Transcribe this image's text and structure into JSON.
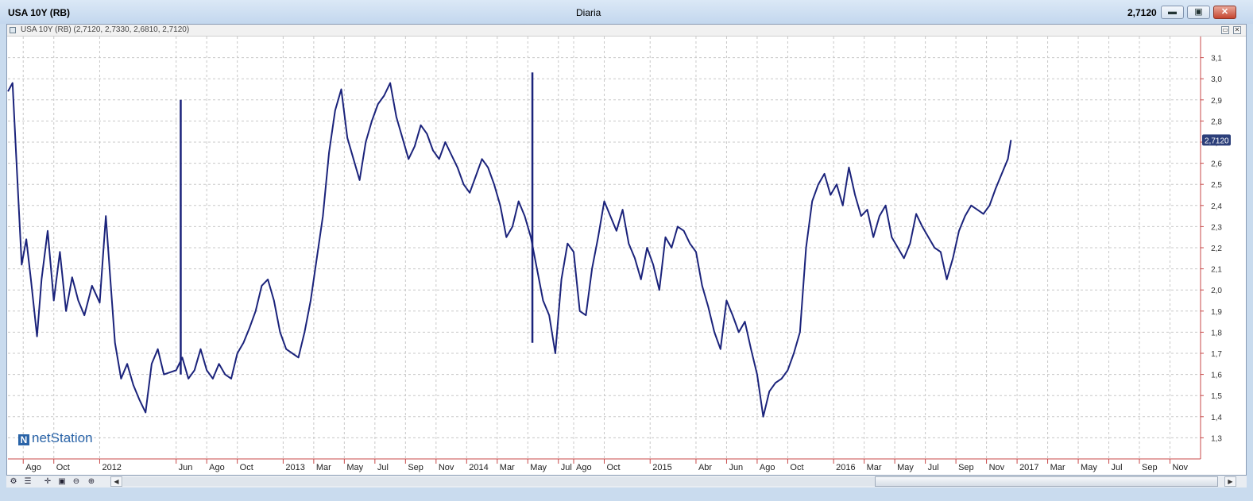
{
  "window": {
    "title": "USA 10Y (RB)",
    "period": "Diaria",
    "last_price": "2,7120",
    "minimize_icon": "minimize-icon",
    "maximize_icon": "maximize-icon",
    "close_icon": "close-icon"
  },
  "info_bar": {
    "text": "USA 10Y (RB) (2,7120, 2,7330, 2,6810, 2,7120)"
  },
  "logo": {
    "text": "netStation"
  },
  "status_bar": {
    "tools": [
      "settings-icon",
      "properties-icon",
      "crosshair-icon",
      "zoom-out-icon",
      "zoom-in-icon"
    ],
    "scroll_left": "◀",
    "scroll_right": "▶"
  },
  "colors": {
    "line": "#1b237b",
    "grid": "#c8c8c8",
    "price_tag_bg": "#2c3f7a",
    "axis_red": "#c84a4a"
  },
  "chart_data": {
    "type": "line",
    "title": "USA 10Y (RB)",
    "ylim": [
      1.2,
      3.2
    ],
    "y_ticks": [
      "1,3",
      "1,4",
      "1,5",
      "1,6",
      "1,7",
      "1,8",
      "1,9",
      "2,0",
      "2,1",
      "2,2",
      "2,3",
      "2,4",
      "2,5",
      "2,6",
      "2,7",
      "2,8",
      "2,9",
      "3,0",
      "3,1"
    ],
    "y_values": [
      1.3,
      1.4,
      1.5,
      1.6,
      1.7,
      1.8,
      1.9,
      2.0,
      2.1,
      2.2,
      2.3,
      2.4,
      2.5,
      2.6,
      2.7,
      2.8,
      2.9,
      3.0,
      3.1
    ],
    "last_value_label": "2,7120",
    "x_ticks": [
      {
        "label": "Ago",
        "month": 7
      },
      {
        "label": "Oct",
        "month": 9
      },
      {
        "label": "2012",
        "month": 12
      },
      {
        "label": "Jun",
        "month": 17
      },
      {
        "label": "Ago",
        "month": 19
      },
      {
        "label": "Oct",
        "month": 21
      },
      {
        "label": "2013",
        "month": 24
      },
      {
        "label": "Mar",
        "month": 26
      },
      {
        "label": "May",
        "month": 28
      },
      {
        "label": "Jul",
        "month": 30
      },
      {
        "label": "Sep",
        "month": 32
      },
      {
        "label": "Nov",
        "month": 34
      },
      {
        "label": "2014",
        "month": 36
      },
      {
        "label": "Mar",
        "month": 38
      },
      {
        "label": "May",
        "month": 40
      },
      {
        "label": "Jul",
        "month": 42
      },
      {
        "label": "Ago",
        "month": 43
      },
      {
        "label": "Oct",
        "month": 45
      },
      {
        "label": "2015",
        "month": 48
      },
      {
        "label": "Abr",
        "month": 51
      },
      {
        "label": "Jun",
        "month": 53
      },
      {
        "label": "Ago",
        "month": 55
      },
      {
        "label": "Oct",
        "month": 57
      },
      {
        "label": "2016",
        "month": 60
      },
      {
        "label": "Mar",
        "month": 62
      },
      {
        "label": "May",
        "month": 64
      },
      {
        "label": "Jul",
        "month": 66
      },
      {
        "label": "Sep",
        "month": 68
      },
      {
        "label": "Nov",
        "month": 70
      },
      {
        "label": "2017",
        "month": 72
      },
      {
        "label": "Mar",
        "month": 74
      },
      {
        "label": "May",
        "month": 76
      },
      {
        "label": "Jul",
        "month": 78
      },
      {
        "label": "Sep",
        "month": 80
      },
      {
        "label": "Nov",
        "month": 82
      }
    ],
    "x_month_range": [
      6,
      84
    ],
    "grid": true,
    "series": [
      {
        "values": [
          [
            6.0,
            2.94
          ],
          [
            6.3,
            2.98
          ],
          [
            6.6,
            2.55
          ],
          [
            6.9,
            2.12
          ],
          [
            7.2,
            2.24
          ],
          [
            7.5,
            2.05
          ],
          [
            7.9,
            1.78
          ],
          [
            8.2,
            2.05
          ],
          [
            8.6,
            2.28
          ],
          [
            9.0,
            1.95
          ],
          [
            9.4,
            2.18
          ],
          [
            9.8,
            1.9
          ],
          [
            10.2,
            2.06
          ],
          [
            10.6,
            1.95
          ],
          [
            11.0,
            1.88
          ],
          [
            11.5,
            2.02
          ],
          [
            12.0,
            1.94
          ],
          [
            12.4,
            2.35
          ],
          [
            12.7,
            2.05
          ],
          [
            13.0,
            1.75
          ],
          [
            13.4,
            1.58
          ],
          [
            13.8,
            1.65
          ],
          [
            14.2,
            1.55
          ],
          [
            14.6,
            1.48
          ],
          [
            15.0,
            1.42
          ],
          [
            15.4,
            1.65
          ],
          [
            15.8,
            1.72
          ],
          [
            16.2,
            1.6
          ],
          [
            17.0,
            1.62
          ],
          [
            17.4,
            1.68
          ],
          [
            17.8,
            1.58
          ],
          [
            18.2,
            1.62
          ],
          [
            18.6,
            1.72
          ],
          [
            19.0,
            1.62
          ],
          [
            19.4,
            1.58
          ],
          [
            19.8,
            1.65
          ],
          [
            20.2,
            1.6
          ],
          [
            20.6,
            1.58
          ],
          [
            21.0,
            1.7
          ],
          [
            21.4,
            1.75
          ],
          [
            21.8,
            1.82
          ],
          [
            22.2,
            1.9
          ],
          [
            22.6,
            2.02
          ],
          [
            23.0,
            2.05
          ],
          [
            23.4,
            1.95
          ],
          [
            23.8,
            1.8
          ],
          [
            24.2,
            1.72
          ],
          [
            24.6,
            1.7
          ],
          [
            25.0,
            1.68
          ],
          [
            25.4,
            1.8
          ],
          [
            25.8,
            1.95
          ],
          [
            26.2,
            2.15
          ],
          [
            26.6,
            2.35
          ],
          [
            27.0,
            2.65
          ],
          [
            27.4,
            2.85
          ],
          [
            27.8,
            2.95
          ],
          [
            28.2,
            2.72
          ],
          [
            28.6,
            2.62
          ],
          [
            29.0,
            2.52
          ],
          [
            29.4,
            2.7
          ],
          [
            29.8,
            2.8
          ],
          [
            30.2,
            2.88
          ],
          [
            30.6,
            2.92
          ],
          [
            31.0,
            2.98
          ],
          [
            31.4,
            2.82
          ],
          [
            31.8,
            2.72
          ],
          [
            32.2,
            2.62
          ],
          [
            32.6,
            2.68
          ],
          [
            33.0,
            2.78
          ],
          [
            33.4,
            2.74
          ],
          [
            33.8,
            2.66
          ],
          [
            34.2,
            2.62
          ],
          [
            34.6,
            2.7
          ],
          [
            35.0,
            2.64
          ],
          [
            35.4,
            2.58
          ],
          [
            35.8,
            2.5
          ],
          [
            36.2,
            2.46
          ],
          [
            36.6,
            2.54
          ],
          [
            37.0,
            2.62
          ],
          [
            37.4,
            2.58
          ],
          [
            37.8,
            2.5
          ],
          [
            38.2,
            2.4
          ],
          [
            38.6,
            2.25
          ],
          [
            39.0,
            2.3
          ],
          [
            39.4,
            2.42
          ],
          [
            39.8,
            2.35
          ],
          [
            40.2,
            2.25
          ],
          [
            40.6,
            2.1
          ],
          [
            41.0,
            1.95
          ],
          [
            41.4,
            1.88
          ],
          [
            41.8,
            1.7
          ],
          [
            42.2,
            2.05
          ],
          [
            42.6,
            2.22
          ],
          [
            43.0,
            2.18
          ],
          [
            43.4,
            1.9
          ],
          [
            43.8,
            1.88
          ],
          [
            44.2,
            2.1
          ],
          [
            44.6,
            2.25
          ],
          [
            45.0,
            2.42
          ],
          [
            45.4,
            2.35
          ],
          [
            45.8,
            2.28
          ],
          [
            46.2,
            2.38
          ],
          [
            46.6,
            2.22
          ],
          [
            47.0,
            2.15
          ],
          [
            47.4,
            2.05
          ],
          [
            47.8,
            2.2
          ],
          [
            48.2,
            2.12
          ],
          [
            48.6,
            2.0
          ],
          [
            49.0,
            2.25
          ],
          [
            49.4,
            2.2
          ],
          [
            49.8,
            2.3
          ],
          [
            50.2,
            2.28
          ],
          [
            50.6,
            2.22
          ],
          [
            51.0,
            2.18
          ],
          [
            51.4,
            2.02
          ],
          [
            51.8,
            1.92
          ],
          [
            52.2,
            1.8
          ],
          [
            52.6,
            1.72
          ],
          [
            53.0,
            1.95
          ],
          [
            53.4,
            1.88
          ],
          [
            53.8,
            1.8
          ],
          [
            54.2,
            1.85
          ],
          [
            54.6,
            1.72
          ],
          [
            55.0,
            1.6
          ],
          [
            55.4,
            1.4
          ],
          [
            55.8,
            1.52
          ],
          [
            56.2,
            1.56
          ],
          [
            56.6,
            1.58
          ],
          [
            57.0,
            1.62
          ],
          [
            57.4,
            1.7
          ],
          [
            57.8,
            1.8
          ],
          [
            58.2,
            2.2
          ],
          [
            58.6,
            2.42
          ],
          [
            59.0,
            2.5
          ],
          [
            59.4,
            2.55
          ],
          [
            59.8,
            2.45
          ],
          [
            60.2,
            2.5
          ],
          [
            60.6,
            2.4
          ],
          [
            61.0,
            2.58
          ],
          [
            61.4,
            2.45
          ],
          [
            61.8,
            2.35
          ],
          [
            62.2,
            2.38
          ],
          [
            62.6,
            2.25
          ],
          [
            63.0,
            2.35
          ],
          [
            63.4,
            2.4
          ],
          [
            63.8,
            2.25
          ],
          [
            64.2,
            2.2
          ],
          [
            64.6,
            2.15
          ],
          [
            65.0,
            2.22
          ],
          [
            65.4,
            2.36
          ],
          [
            65.8,
            2.3
          ],
          [
            66.2,
            2.25
          ],
          [
            66.6,
            2.2
          ],
          [
            67.0,
            2.18
          ],
          [
            67.4,
            2.05
          ],
          [
            67.8,
            2.15
          ],
          [
            68.2,
            2.28
          ],
          [
            68.6,
            2.35
          ],
          [
            69.0,
            2.4
          ],
          [
            69.4,
            2.38
          ],
          [
            69.8,
            2.36
          ],
          [
            70.2,
            2.4
          ],
          [
            70.6,
            2.48
          ],
          [
            71.0,
            2.55
          ],
          [
            71.4,
            2.62
          ],
          [
            71.6,
            2.71
          ]
        ]
      }
    ],
    "spikes": [
      {
        "month": 17.3,
        "high": 2.9,
        "low": 1.6
      },
      {
        "month": 40.3,
        "high": 3.03,
        "low": 1.75
      }
    ]
  }
}
